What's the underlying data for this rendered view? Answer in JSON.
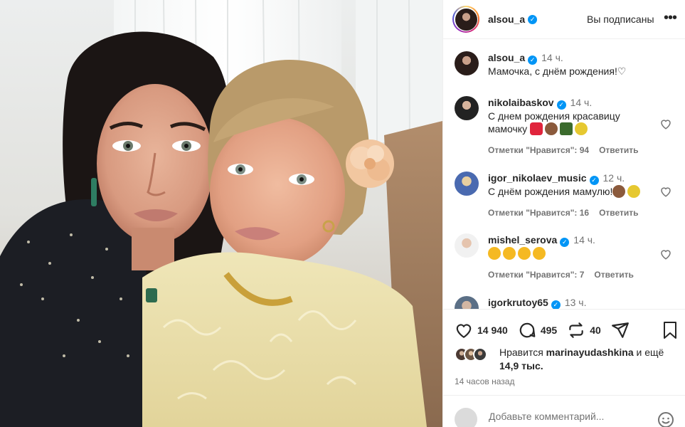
{
  "photo": {
    "alt_subject": "selfie-photo"
  },
  "header": {
    "username": "alsou_a",
    "follow_status": "Вы подписаны",
    "more_label": "•••"
  },
  "caption": {
    "username": "alsou_a",
    "time": "14 ч.",
    "text": "Мамочка, с днём рождения!"
  },
  "comments": [
    {
      "username": "nikolaibaskov",
      "time": "14 ч.",
      "text": "С днем рождения красавицу мамочку",
      "emojis": [
        "heart",
        "cake",
        "champagne",
        "bouquet"
      ],
      "likes": "Отметки \"Нравится\": 94",
      "reply": "Ответить"
    },
    {
      "username": "igor_nikolaev_music",
      "time": "12 ч.",
      "text": "С днём рождения мамулю!",
      "emojis": [
        "cake",
        "bouquet"
      ],
      "likes": "Отметки \"Нравится\": 16",
      "reply": "Ответить"
    },
    {
      "username": "mishel_serova",
      "time": "14 ч.",
      "text": "",
      "emojis": [
        "heart-eyes",
        "heart-eyes",
        "heart-eyes",
        "heart-eyes"
      ],
      "likes": "Отметки \"Нравится\": 7",
      "reply": "Ответить"
    },
    {
      "username": "igorkrutoy65",
      "time": "13 ч.",
      "text": "",
      "emojis": [],
      "likes": "",
      "reply": ""
    }
  ],
  "actions": {
    "likes_count": "14 940",
    "comments_count": "495",
    "reposts_count": "40"
  },
  "liked_by": {
    "prefix": "Нравится",
    "user": "marinayudashkina",
    "suffix": "и ещё",
    "more": "14,9 тыс."
  },
  "posted_ago": "14 часов назад",
  "add_comment": {
    "placeholder": "Добавьте комментарий..."
  },
  "colors": {
    "verified": "#0095f6",
    "meta_gray": "#737373",
    "text": "#262626"
  }
}
